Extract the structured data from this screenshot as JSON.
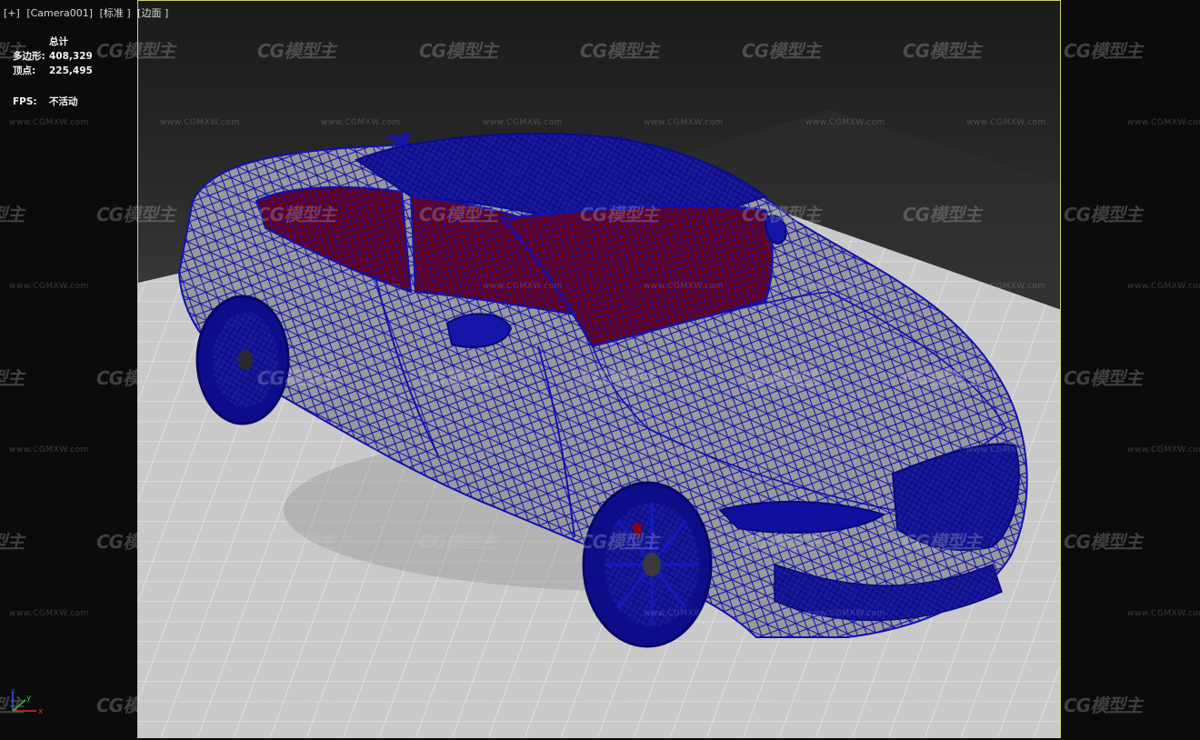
{
  "viewport": {
    "labels": [
      "[+]",
      "[Camera001]",
      "[标准 ]",
      "[边面 ]"
    ]
  },
  "stats": {
    "header": "总计",
    "polygons_label": "多边形:",
    "polygons_value": "408,329",
    "vertices_label": "顶点:",
    "vertices_value": "225,495",
    "fps_label": "FPS:",
    "fps_value": "不活动"
  },
  "axis": {
    "x": "x",
    "y": "y",
    "z": "z"
  },
  "watermark": {
    "logo_text": "CG模型主",
    "url_text": "www.CGMXW.com"
  },
  "colors": {
    "wire": "#1010b0",
    "floor": "#c9c9c9",
    "interior": "#7a0010",
    "frame": "#cfcf6a"
  }
}
